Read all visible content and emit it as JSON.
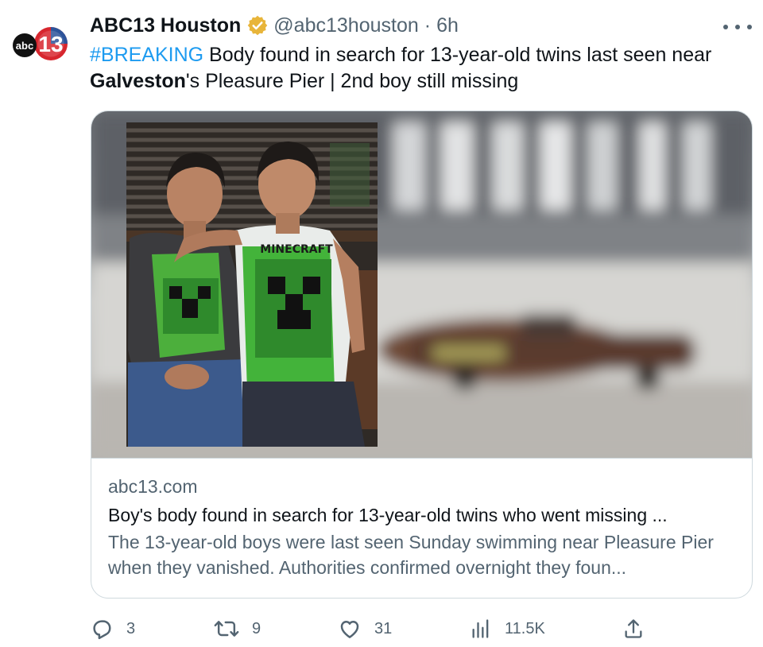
{
  "account": {
    "display_name": "ABC13 Houston",
    "handle": "@abc13houston",
    "separator": "·",
    "time": "6h",
    "avatar_icon": "abc13-logo-icon",
    "verified_icon": "verified-badge-icon",
    "logo_text_abc": "abc",
    "logo_text_13": "13"
  },
  "tweet": {
    "hashtag": "#BREAKING",
    "text_1": " Body found in search for 13-year-old twins last seen near ",
    "text_bold": "Galveston",
    "text_2": "'s Pleasure Pier | 2nd boy still missing"
  },
  "card": {
    "image_subject": "twin-boys-photo-over-blurred-beach-scene",
    "shirt_text": "MINECRAFT",
    "domain": "abc13.com",
    "title": "Boy's body found in search for 13-year-old twins who went missing ...",
    "description": "The 13-year-old boys were last seen Sunday swimming near Pleasure Pier when they vanished. Authorities confirmed overnight they foun..."
  },
  "actions": {
    "replies": "3",
    "retweets": "9",
    "likes": "31",
    "views": "11.5K",
    "reply_icon": "reply-icon",
    "retweet_icon": "retweet-icon",
    "like_icon": "heart-icon",
    "views_icon": "analytics-icon",
    "share_icon": "share-icon"
  },
  "colors": {
    "accent": "#1d9bf0",
    "secondary_text": "#536471",
    "primary_text": "#0f1419",
    "verified_gold": "#e8b53a",
    "abc13_red": "#d7262e",
    "abc13_blue": "#1b5aa6"
  }
}
